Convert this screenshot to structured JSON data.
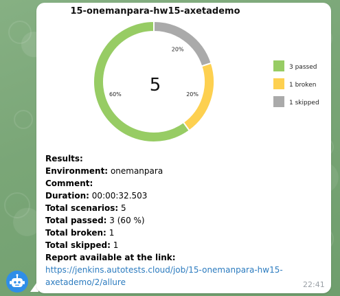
{
  "chat": {
    "time": "22:41",
    "avatar_icon": "robot-icon"
  },
  "results": {
    "header": "Results:",
    "environment_label": "Environment:",
    "environment_value": "onemanpara",
    "comment_label": "Comment:",
    "duration_label": "Duration:",
    "duration_value": "00:00:32.503",
    "total_scenarios_label": "Total scenarios:",
    "total_scenarios_value": "5",
    "total_passed_label": "Total passed:",
    "total_passed_value": "3 (60 %)",
    "total_broken_label": "Total broken:",
    "total_broken_value": "1",
    "total_skipped_label": "Total skipped:",
    "total_skipped_value": "1",
    "report_label": "Report available at the link:",
    "report_link": "https://jenkins.autotests.cloud/job/15-onemanpara-hw15-axetademo/2/allure"
  },
  "colors": {
    "passed": "#97cc64",
    "broken": "#fdd050",
    "skipped": "#aaaaaa",
    "link": "#2b7bbf"
  },
  "chart_data": {
    "type": "pie",
    "title": "15-onemanpara-hw15-axetademo",
    "center_label": "5",
    "slices": [
      {
        "name": "3 passed",
        "value": 3,
        "label": "60%",
        "color": "#97cc64"
      },
      {
        "name": "1 broken",
        "value": 1,
        "label": "20%",
        "color": "#fdd050"
      },
      {
        "name": "1 skipped",
        "value": 1,
        "label": "20%",
        "color": "#aaaaaa"
      }
    ],
    "legend_placement": "right"
  }
}
